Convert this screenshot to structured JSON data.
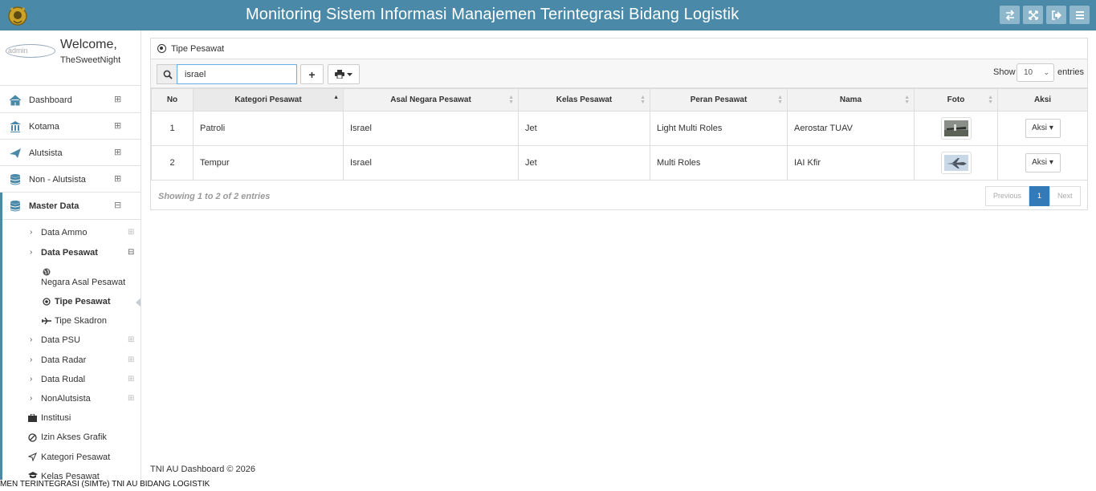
{
  "header": {
    "title": "Monitoring Sistem Informasi Manajemen Terintegrasi Bidang Logistik",
    "buttons": [
      "switch-icon",
      "fullscreen-icon",
      "logout-icon",
      "menu-icon"
    ]
  },
  "profile": {
    "avatar_text": "admin",
    "welcome": "Welcome,",
    "username": "TheSweetNight"
  },
  "sidebar": {
    "items": [
      {
        "label": "Dashboard",
        "icon": "home-icon"
      },
      {
        "label": "Kotama",
        "icon": "bank-icon"
      },
      {
        "label": "Alutsista",
        "icon": "plane-icon"
      },
      {
        "label": "Non - Alutsista",
        "icon": "database-icon"
      },
      {
        "label": "Master Data",
        "icon": "database-icon"
      }
    ],
    "expand_symbol": "⊞",
    "collapse_symbol": "⊟",
    "master": {
      "data_ammo": "Data Ammo",
      "data_pesawat": "Data Pesawat",
      "negara_asal": "Negara Asal Pesawat",
      "tipe_pesawat": "Tipe Pesawat",
      "tipe_skadron": "Tipe Skadron",
      "data_psu": "Data PSU",
      "data_radar": "Data Radar",
      "data_rudal": "Data Rudal",
      "nonalutsista": "NonAlutsista",
      "institusi": "Institusi",
      "izin_akses": "Izin Akses Grafik",
      "kategori_pesawat": "Kategori Pesawat",
      "kelas_pesawat": "Kelas Pesawat"
    }
  },
  "panel": {
    "title": "Tipe Pesawat",
    "search_value": "israel",
    "add_label": "+",
    "show_label": "Show",
    "entries_value": "10",
    "entries_label": "entries"
  },
  "table": {
    "headers": [
      "No",
      "Kategori Pesawat",
      "Asal Negara Pesawat",
      "Kelas Pesawat",
      "Peran Pesawat",
      "Nama",
      "Foto",
      "Aksi"
    ],
    "rows": [
      {
        "no": "1",
        "kategori": "Patroli",
        "asal": "Israel",
        "kelas": "Jet",
        "peran": "Light Multi Roles",
        "nama": "Aerostar TUAV",
        "aksi": "Aksi"
      },
      {
        "no": "2",
        "kategori": "Tempur",
        "asal": "Israel",
        "kelas": "Jet",
        "peran": "Multi Roles",
        "nama": "IAI Kfir",
        "aksi": "Aksi"
      }
    ]
  },
  "info": "Showing 1 to 2 of 2 entries",
  "pagination": {
    "previous": "Previous",
    "current": "1",
    "next": "Next"
  },
  "footer": "TNI AU Dashboard © 2026",
  "ticker": "MEN TERINTEGRASI (SIMTe) TNI AU BIDANG LOGISTIK",
  "colors": {
    "header": "#4a8aa8",
    "header_button": "#8fb7cc",
    "pager_active": "#337ab7"
  }
}
